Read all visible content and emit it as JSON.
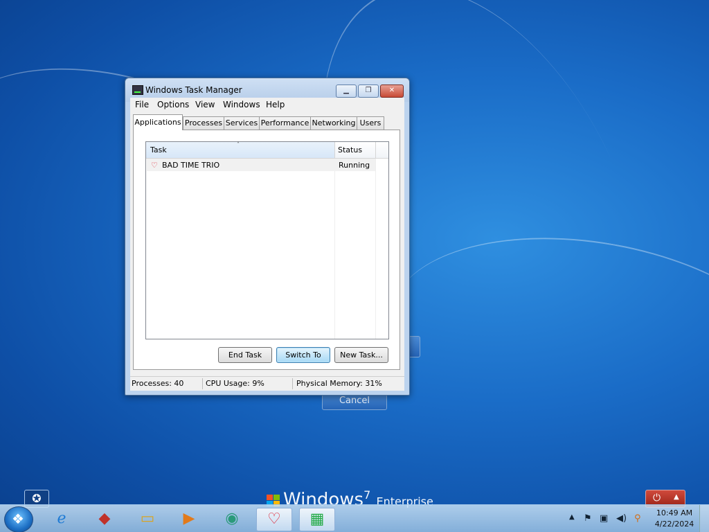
{
  "window": {
    "title": "Windows Task Manager",
    "min_glyph": "▁",
    "max_glyph": "❐",
    "close_glyph": "✕",
    "menu": [
      "File",
      "Options",
      "View",
      "Windows",
      "Help"
    ],
    "tabs": [
      "Applications",
      "Processes",
      "Services",
      "Performance",
      "Networking",
      "Users"
    ],
    "active_tab": "Applications"
  },
  "applications": {
    "columns": {
      "task": "Task",
      "status": "Status"
    },
    "sort_arrow": "˄",
    "rows": [
      {
        "icon": "heart-icon",
        "task": "BAD TIME TRIO",
        "status": "Running"
      }
    ],
    "buttons": {
      "end_task": "End Task",
      "switch_to": "Switch To",
      "new_task": "New Task..."
    }
  },
  "statusbar": {
    "processes": "Processes: 40",
    "cpu": "CPU Usage: 9%",
    "memory": "Physical Memory: 31%"
  },
  "background": {
    "cancel_label": "Cancel",
    "branding_text": "Windows",
    "branding_version": "7",
    "branding_edition": "Enterprise"
  },
  "taskbar": {
    "apps": [
      "windows-explorer-ie-icon",
      "gamemaker-icon",
      "folder-icon",
      "media-player-icon",
      "browser-icon",
      "heart-app-icon",
      "task-manager-icon"
    ],
    "clock_time": "10:49 AM",
    "clock_date": "4/22/2024"
  },
  "colors": {
    "desktop": "#1a6cc7",
    "window_frame": "#bcd3ee",
    "accent": "#3c7fb1"
  }
}
